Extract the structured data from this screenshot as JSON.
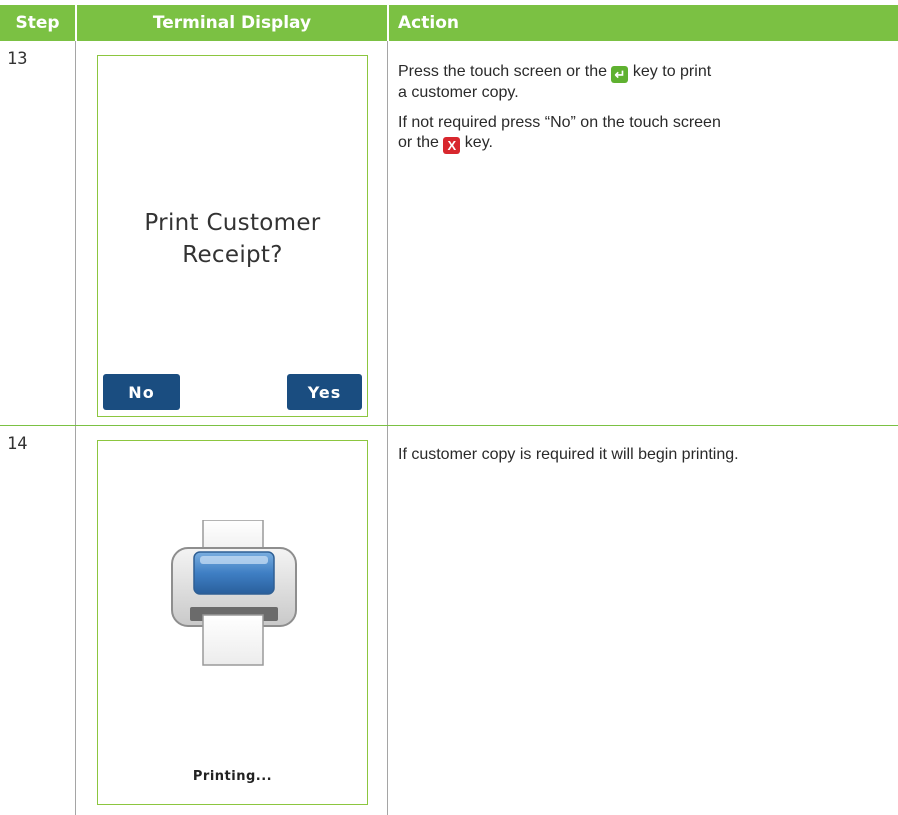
{
  "header": {
    "step": "Step",
    "display": "Terminal Display",
    "action": "Action"
  },
  "rows": [
    {
      "step": "13",
      "screen": {
        "prompt_line1": "Print Customer",
        "prompt_line2": "Receipt?",
        "no_button": "No",
        "yes_button": "Yes"
      },
      "action": {
        "p1_before_key": "Press the touch screen or the ",
        "p1_key_icon": "enter-key-icon",
        "p1_after_key_line1": " key to print",
        "p1_line2": "a customer copy.",
        "p2_line1": "If not required press “No” on the touch screen",
        "p2_before_key": "or the ",
        "p2_key_icon": "cancel-key-icon",
        "p2_after_key": " key."
      }
    },
    {
      "step": "14",
      "screen": {
        "icon": "printer-icon",
        "status": "Printing..."
      },
      "action": {
        "text": "If customer copy is required it will begin printing."
      }
    }
  ],
  "colors": {
    "header_green": "#7bc143",
    "button_blue": "#1a4d80",
    "enter_key_green": "#5fb130",
    "cancel_key_red": "#d8272e"
  }
}
